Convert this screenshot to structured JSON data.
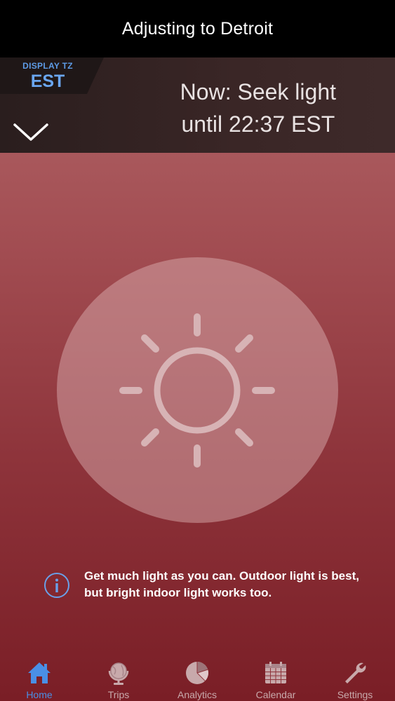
{
  "header": {
    "title": "Adjusting to Detroit"
  },
  "timezone": {
    "caption": "DISPLAY TZ",
    "value": "EST"
  },
  "status": {
    "line1": "Now: Seek light",
    "line2": "until 22:37 EST"
  },
  "tip": {
    "line1": "Get much light as you can. Outdoor light is best,",
    "line2": "but bright indoor light works too."
  },
  "tabs": [
    {
      "label": "Home",
      "icon": "home-icon",
      "active": true
    },
    {
      "label": "Trips",
      "icon": "globe-icon",
      "active": false
    },
    {
      "label": "Analytics",
      "icon": "pie-chart-icon",
      "active": false
    },
    {
      "label": "Calendar",
      "icon": "calendar-icon",
      "active": false
    },
    {
      "label": "Settings",
      "icon": "wrench-icon",
      "active": false
    }
  ],
  "colors": {
    "accent": "#4a8fe6",
    "title_bar": "#000000",
    "background_top": "#b46a6c",
    "background_bottom": "#7a1e26",
    "inactive_tab": "#c8a9ab"
  }
}
